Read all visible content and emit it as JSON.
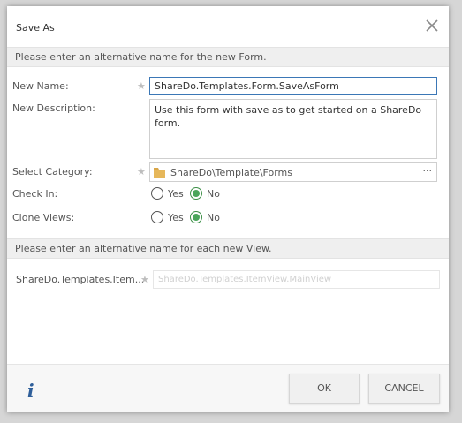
{
  "dialog": {
    "title": "Save As",
    "close_icon": "close-icon"
  },
  "form_section": {
    "heading": "Please enter an alternative name for the new Form.",
    "new_name_label": "New Name:",
    "new_name_value": "ShareDo.Templates.Form.SaveAsForm",
    "new_description_label": "New Description:",
    "new_description_value": "Use this form with save as to get started on a ShareDo form.",
    "category_label": "Select Category:",
    "category_value": "ShareDo\\Template\\Forms",
    "category_browse": "···",
    "check_in_label": "Check In:",
    "check_in_options": [
      "Yes",
      "No"
    ],
    "check_in_selected": "No",
    "clone_views_label": "Clone Views:",
    "clone_views_options": [
      "Yes",
      "No"
    ],
    "clone_views_selected": "No",
    "required_marker": "★"
  },
  "views_section": {
    "heading": "Please enter an alternative name for each new View.",
    "view_label": "ShareDo.Templates.Item...",
    "view_value": "ShareDo.Templates.ItemView.MainView"
  },
  "footer": {
    "info_label": "i",
    "ok_label": "OK",
    "cancel_label": "CANCEL"
  },
  "colors": {
    "focus_border": "#3b77b6",
    "radio_selected": "#4aa55a",
    "info_icon": "#2f5f9a",
    "folder": "#d9a648"
  }
}
